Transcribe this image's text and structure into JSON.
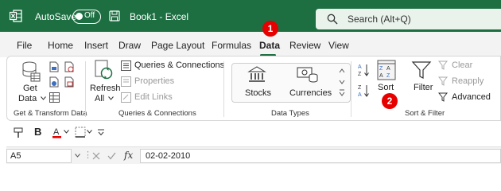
{
  "titlebar": {
    "autosave_label": "AutoSave",
    "autosave_state": "Off",
    "document_title": "Book1  -  Excel",
    "search_placeholder": "Search (Alt+Q)"
  },
  "tabs": [
    "File",
    "Home",
    "Insert",
    "Draw",
    "Page Layout",
    "Formulas",
    "Data",
    "Review",
    "View"
  ],
  "active_tab": "Data",
  "markers": [
    "1",
    "2"
  ],
  "ribbon": {
    "get_data": {
      "line1": "Get",
      "line2": "Data"
    },
    "refresh": {
      "line1": "Refresh",
      "line2": "All"
    },
    "queries_connections": "Queries & Connections",
    "properties": "Properties",
    "edit_links": "Edit Links",
    "stocks": "Stocks",
    "currencies": "Currencies",
    "sort": "Sort",
    "filter": "Filter",
    "clear": "Clear",
    "reapply": "Reapply",
    "advanced": "Advanced",
    "groups": {
      "get_transform": "Get & Transform Data",
      "queries": "Queries & Connections",
      "data_types": "Data Types",
      "sort_filter": "Sort & Filter"
    }
  },
  "formula_bar": {
    "name_box": "A5",
    "fx": "fx",
    "value": "02-02-2010"
  },
  "colors": {
    "brand_green": "#1d6f42",
    "marker_red": "#e60000"
  },
  "icons": [
    "excel-logo-icon",
    "save-icon",
    "search-icon",
    "database-icon",
    "refresh-icon",
    "bank-icon",
    "currency-icon",
    "sort-az-icon",
    "sort-za-icon",
    "sort-icon",
    "funnel-icon",
    "bold-icon",
    "font-color-icon",
    "borders-icon",
    "cancel-icon",
    "enter-icon"
  ]
}
